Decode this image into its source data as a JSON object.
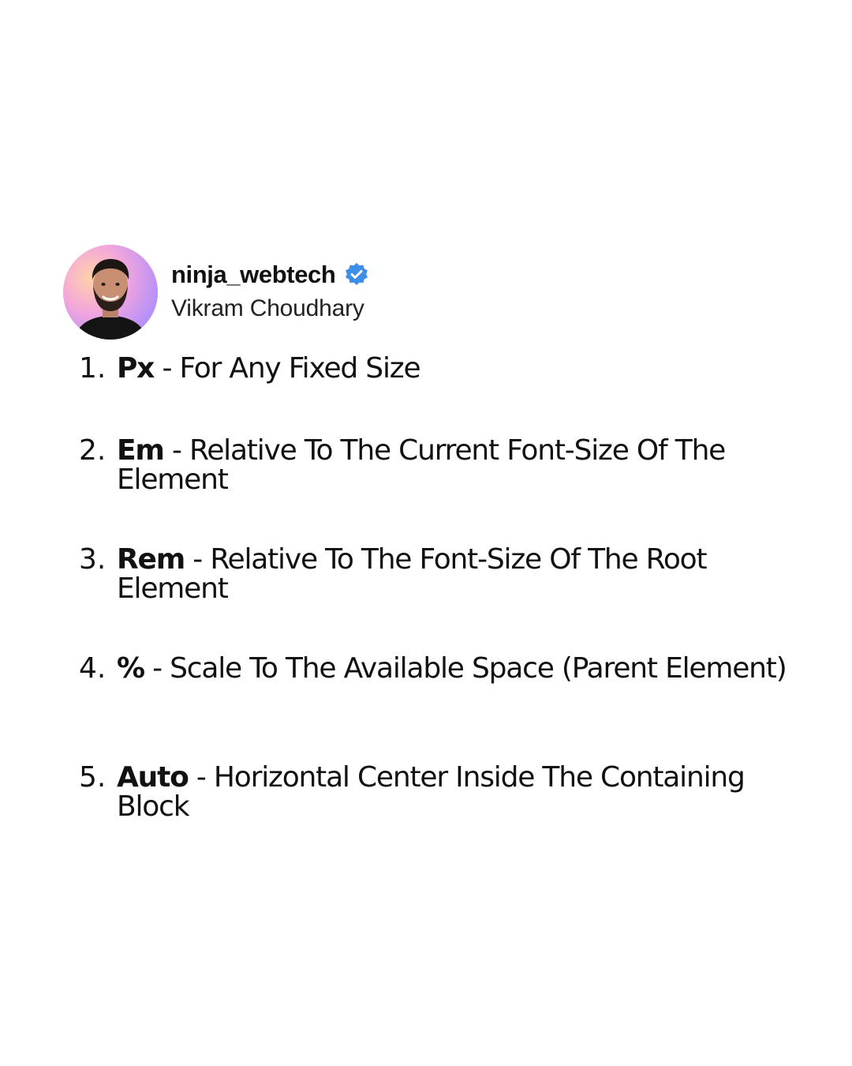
{
  "author": {
    "handle": "ninja_webtech",
    "display_name": "Vikram Choudhary",
    "verified_icon": "verified-badge-icon",
    "verified_color": "#3d8ee8"
  },
  "items": [
    {
      "number": "1.",
      "term": "Px",
      "description": " - For Any Fixed Size"
    },
    {
      "number": "2.",
      "term": "Em",
      "description": " - Relative To The Current Font-Size Of The Element"
    },
    {
      "number": "3.",
      "term": "Rem",
      "description": " - Relative To The Font-Size Of The Root Element"
    },
    {
      "number": "4.",
      "term": "%",
      "description": " - Scale To The Available Space (Parent Element)"
    },
    {
      "number": "5.",
      "term": "Auto",
      "description": " - Horizontal Center Inside The Containing Block"
    }
  ]
}
